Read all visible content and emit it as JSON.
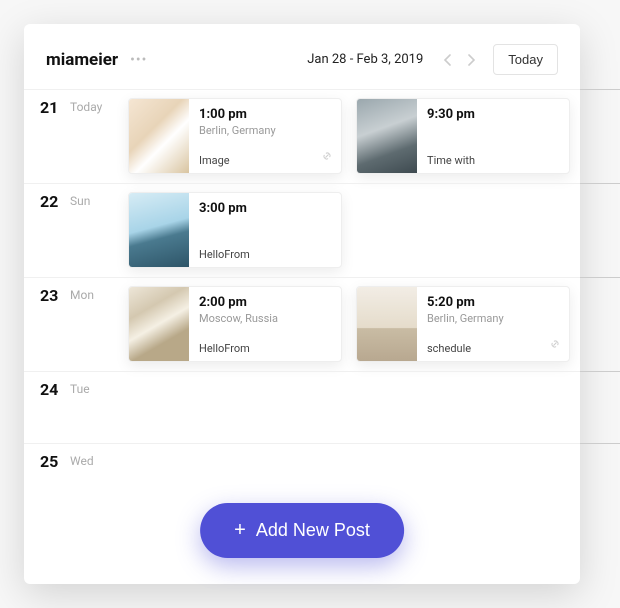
{
  "header": {
    "username": "miameier",
    "date_range": "Jan 28 - Feb 3, 2019",
    "today_label": "Today"
  },
  "add_button": "Add New Post",
  "days": [
    {
      "num": "21",
      "name": "Today",
      "events": [
        {
          "time": "1:00 pm",
          "location": "Berlin, Germany",
          "tag": "Image",
          "link": true,
          "thumb": "t1"
        },
        {
          "time": "9:30 pm",
          "location": "",
          "tag": "Time with",
          "link": false,
          "thumb": "t2"
        }
      ]
    },
    {
      "num": "22",
      "name": "Sun",
      "events": [
        {
          "time": "3:00 pm",
          "location": "",
          "tag": "HelloFrom",
          "link": false,
          "thumb": "t3"
        }
      ]
    },
    {
      "num": "23",
      "name": "Mon",
      "events": [
        {
          "time": "2:00 pm",
          "location": "Moscow, Russia",
          "tag": "HelloFrom",
          "link": false,
          "thumb": "t4"
        },
        {
          "time": "5:20 pm",
          "location": "Berlin, Germany",
          "tag": "schedule",
          "link": true,
          "thumb": "t5"
        }
      ]
    },
    {
      "num": "24",
      "name": "Tue",
      "events": []
    },
    {
      "num": "25",
      "name": "Wed",
      "events": []
    }
  ]
}
